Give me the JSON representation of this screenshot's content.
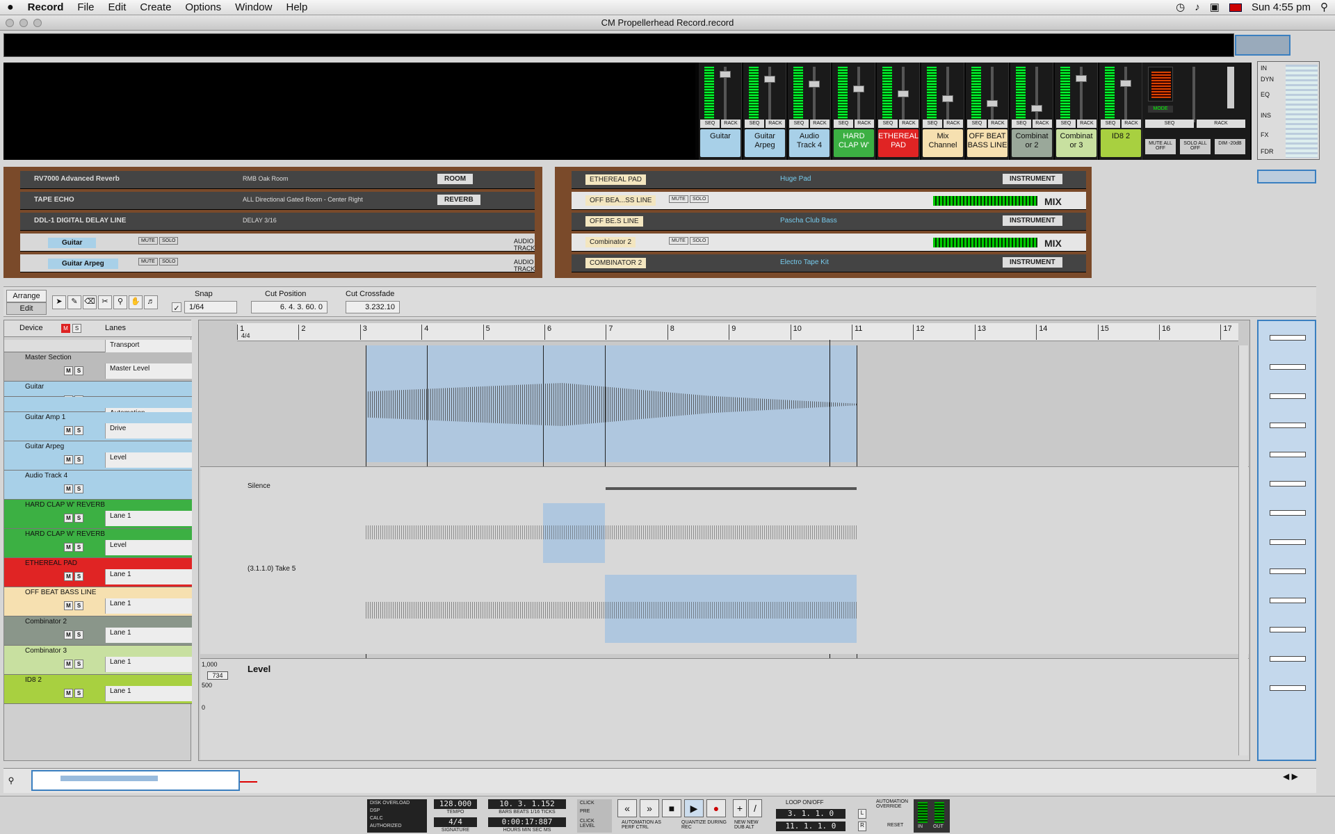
{
  "menubar": {
    "apple": "",
    "app": "Record",
    "items": [
      "File",
      "Edit",
      "Create",
      "Options",
      "Window",
      "Help"
    ],
    "clock": "Sun 4:55 pm"
  },
  "window": {
    "title": "CM Propellerhead Record.record"
  },
  "mixer": {
    "channels": [
      {
        "label": "Guitar",
        "color": "#a8d0e8"
      },
      {
        "label": "Guitar Arpeg",
        "color": "#a8d0e8"
      },
      {
        "label": "Audio Track 4",
        "color": "#a8d0e8"
      },
      {
        "label": "HARD CLAP W'",
        "color": "#3cb043"
      },
      {
        "label": "ETHEREAL PAD",
        "color": "#e02424"
      },
      {
        "label": "Mix Channel",
        "color": "#f6e0b0"
      },
      {
        "label": "OFF BEAT BASS LINE",
        "color": "#f6e0b0"
      },
      {
        "label": "Combinat or 2",
        "color": "#9aa89a"
      },
      {
        "label": "Combinat or 3",
        "color": "#c8e0a0"
      },
      {
        "label": "ID8 2",
        "color": "#a8d040"
      }
    ],
    "seq": "SEQ",
    "rack": "RACK",
    "master_buttons": [
      "MUTE ALL OFF",
      "SOLO ALL OFF",
      "DIM -20dB"
    ],
    "mode": "MODE",
    "right_labels": [
      "IN",
      "DYN",
      "EQ",
      "INS",
      "FX",
      "FDR"
    ]
  },
  "rack": {
    "left": [
      {
        "name": "RV7000 Advanced Reverb",
        "detail": "RMB Oak Room",
        "preset": "ROOM"
      },
      {
        "name": "TAPE ECHO",
        "detail": "ALL Directional Gated Room - Center Right",
        "preset": "REVERB"
      },
      {
        "name": "DDL-1 DIGITAL DELAY LINE",
        "detail": "DELAY 3/16"
      },
      {
        "name": "Guitar",
        "detail": "AUDIO TRACK"
      },
      {
        "name": "Guitar Arpeg",
        "detail": "AUDIO TRACK"
      }
    ],
    "right": [
      {
        "name": "ETHEREAL PAD",
        "detail": "Huge Pad",
        "preset": "INSTRUMENT"
      },
      {
        "name": "OFF BEA...SS LINE",
        "detail": "MIX"
      },
      {
        "name": "OFF BE.S LINE",
        "detail": "Pascha Club Bass",
        "preset": "INSTRUMENT"
      },
      {
        "name": "Combinator 2",
        "detail": "MIX"
      },
      {
        "name": "COMBINATOR 2",
        "detail": "Electro Tape Kit",
        "preset": "INSTRUMENT"
      }
    ],
    "mute": "MUTE",
    "solo": "SOLO"
  },
  "toolbar": {
    "arrange": "Arrange",
    "edit": "Edit",
    "snap_label": "Snap",
    "snap_value": "1/64",
    "cut_position_label": "Cut Position",
    "cut_position_value": "6. 4. 3. 60. 0",
    "cut_crossfade_label": "Cut Crossfade",
    "cut_crossfade_value": "3.232.10"
  },
  "trackpanel": {
    "device": "Device",
    "lanes": "Lanes",
    "tracks": [
      {
        "name": "",
        "lane": "Transport",
        "color": "#ddd"
      },
      {
        "name": "Master Section",
        "lane": "Master Level",
        "color": "#bbb"
      },
      {
        "name": "Guitar",
        "lane": "",
        "color": "#a8d0e8"
      },
      {
        "name": "",
        "lane": "Automation",
        "color": "#a8d0e8"
      },
      {
        "name": "Guitar Amp 1",
        "lane": "Drive",
        "color": "#a8d0e8"
      },
      {
        "name": "Guitar Arpeg",
        "lane": "Level",
        "color": "#a8d0e8"
      },
      {
        "name": "Audio Track 4",
        "lane": "",
        "color": "#a8d0e8"
      },
      {
        "name": "HARD CLAP W' REVERB",
        "lane": "Lane 1",
        "color": "#3cb043"
      },
      {
        "name": "HARD CLAP W' REVERB",
        "lane": "Level",
        "color": "#3cb043"
      },
      {
        "name": "ETHEREAL PAD",
        "lane": "Lane 1",
        "color": "#e02424"
      },
      {
        "name": "OFF BEAT BASS LINE",
        "lane": "Lane 1",
        "color": "#f6e0b0"
      },
      {
        "name": "Combinator 2",
        "lane": "Lane 1",
        "color": "#8a968a"
      },
      {
        "name": "Combinator 3",
        "lane": "Lane 1",
        "color": "#c8e0a0"
      },
      {
        "name": "ID8 2",
        "lane": "Lane 1",
        "color": "#a8d040"
      }
    ],
    "m": "M",
    "s": "S"
  },
  "arrange": {
    "ruler": [
      "1",
      "2",
      "3",
      "4",
      "5",
      "6",
      "7",
      "8",
      "9",
      "10",
      "11",
      "12",
      "13",
      "14",
      "15",
      "16",
      "17"
    ],
    "timesig": "4/4",
    "silence": "Silence",
    "take": "(3.1.1.0) Take 5",
    "level_lane": "Level",
    "level_values": [
      "1,000",
      "734",
      "500",
      "0"
    ]
  },
  "transport": {
    "disk_overload": "DISK OVERLOAD",
    "dsp": "DSP",
    "calc": "CALC",
    "authorized": "AUTHORIZED",
    "tempo": "128.000",
    "tempo_label": "TEMPO",
    "signature": "4/4",
    "signature_label": "SIGNATURE",
    "position": "10. 3. 1.152",
    "position_label": "BARS BEATS 1/16 TICKS",
    "time": "0:00:17:887",
    "time_label": "HOURS MIN SEC MS",
    "click": "CLICK",
    "pre": "PRE",
    "click_level": "CLICK LEVEL",
    "automation": "AUTOMATION AS PERF CTRL",
    "quantize": "QUANTIZE DURING REC",
    "new": "NEW NEW DUB ALT",
    "loop": "LOOP ON/OFF",
    "loop_left": "3. 1. 1. 0",
    "loop_right": "11. 1. 1. 0",
    "l": "L",
    "r": "R",
    "auto_override": "AUTOMATION OVERRIDE",
    "reset": "RESET",
    "in": "IN",
    "out": "OUT"
  }
}
